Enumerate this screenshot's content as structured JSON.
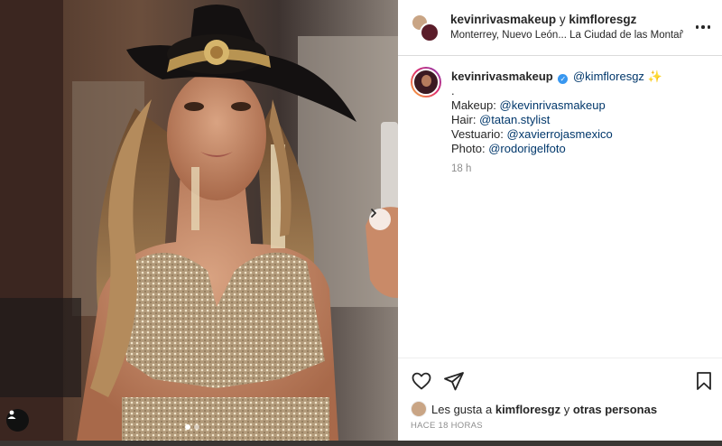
{
  "header": {
    "user1": "kevinrivasmakeup",
    "joiner": "y",
    "user2": "kimfloresgz",
    "location": "Monterrey, Nuevo León... La Ciudad de las Montañas"
  },
  "caption": {
    "username": "kevinrivasmakeup",
    "verified_icon": "verified-badge-icon",
    "mention_main": "@kimfloresgz",
    "sparkle": "✨",
    "dot_line": ".",
    "lines": [
      {
        "label": "Makeup:",
        "mention": "@kevinrivasmakeup"
      },
      {
        "label": "Hair:",
        "mention": "@tatan.stylist"
      },
      {
        "label": "Vestuario:",
        "mention": "@xavierrojasmexico"
      },
      {
        "label": "Photo:",
        "mention": "@rodorigelfoto"
      }
    ],
    "time": "18 h"
  },
  "likes": {
    "prefix": "Les gusta a",
    "user": "kimfloresgz",
    "joiner": "y",
    "others": "otras personas"
  },
  "post_time": "HACE 18 HORAS",
  "carousel": {
    "current": 1,
    "total": 2
  },
  "icons": [
    "more-options-icon",
    "heart-icon",
    "share-icon",
    "bookmark-icon",
    "chevron-right-icon",
    "user-tag-icon"
  ],
  "colors": {
    "mention": "#00376b",
    "verified": "#3897f0",
    "muted": "#8e8e8e"
  }
}
